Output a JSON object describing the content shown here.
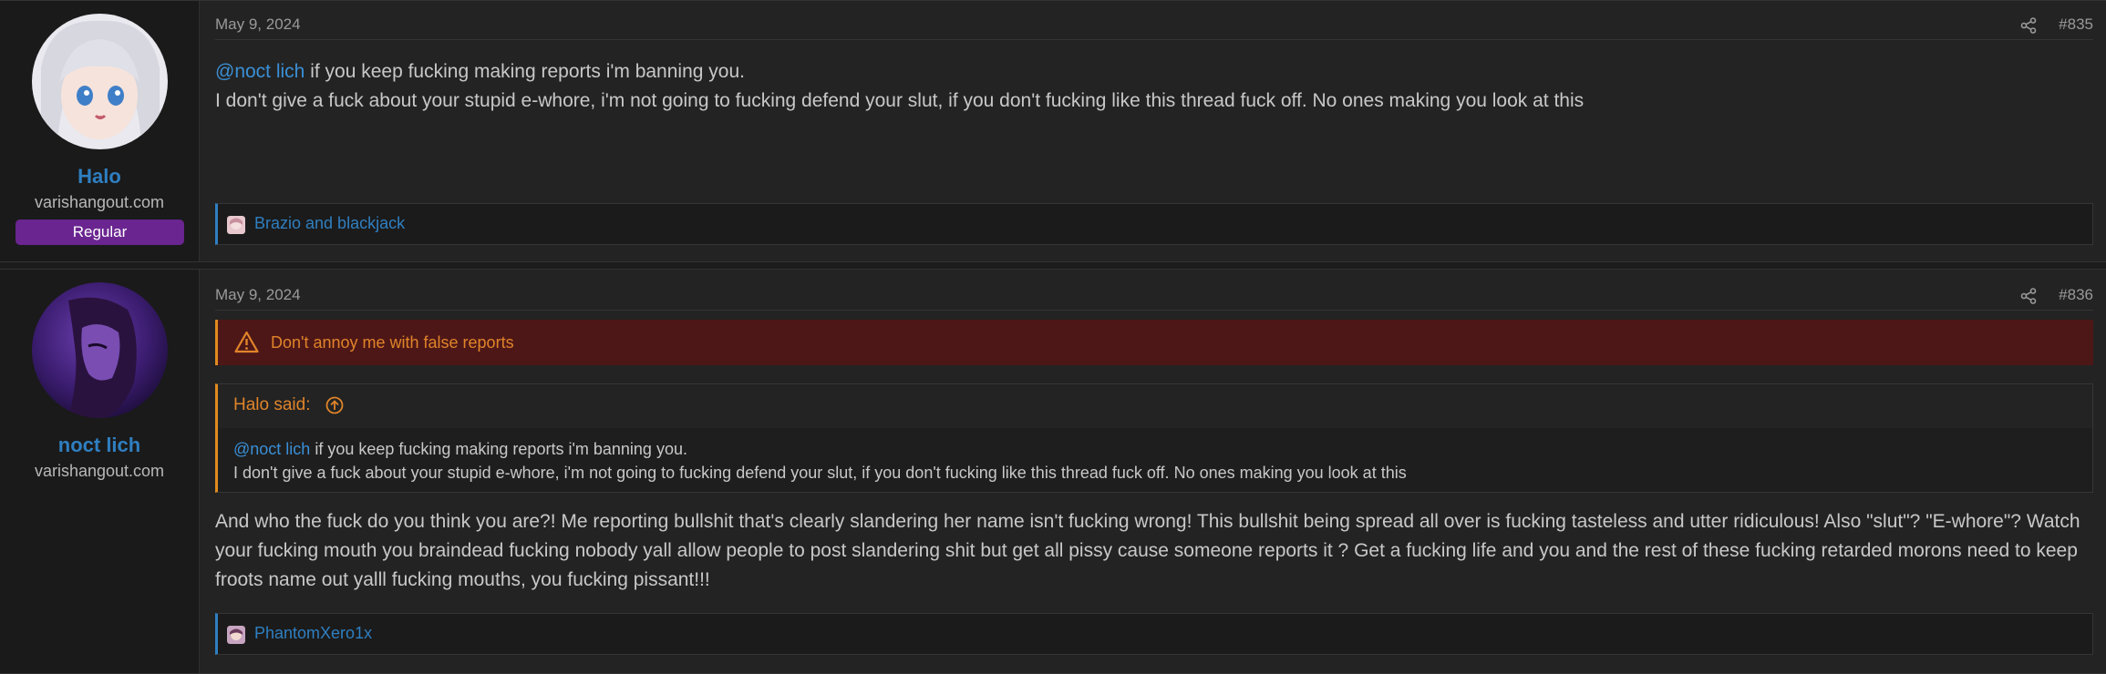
{
  "posts": [
    {
      "username": "Halo",
      "site": "varishangout.com",
      "banner": "Regular",
      "date": "May 9, 2024",
      "number": "#835",
      "mention": "@noct lich",
      "line1_rest": " if you keep fucking making reports i'm banning you.",
      "line2": "I don't give a fuck about your stupid e-whore, i'm not going to fucking defend your slut, if you don't fucking like this thread fuck off. No ones making you look at this",
      "reactions": "Brazio and blackjack"
    },
    {
      "username": "noct lich",
      "site": "varishangout.com",
      "date": "May 9, 2024",
      "number": "#836",
      "notice": "Don't annoy me with false reports",
      "quote": {
        "author": "Halo said:",
        "mention": "@noct lich",
        "line1_rest": " if you keep fucking making reports i'm banning you.",
        "line2": "I don't give a fuck about your stupid e-whore, i'm not going to fucking defend your slut, if you don't fucking like this thread fuck off. No ones making you look at this"
      },
      "body": "And who the fuck do you think you are?! Me reporting bullshit that's clearly slandering her name isn't fucking wrong! This bullshit being spread all over is fucking tasteless and utter ridiculous! Also \"slut\"? \"E-whore\"? Watch your fucking mouth you braindead fucking nobody yall allow people to post slandering shit but get all pissy cause someone reports it ? Get a fucking life and you and the rest of these fucking retarded morons need to keep froots name out yalll fucking mouths, you fucking pissant!!!",
      "reactions": "PhantomXero1x"
    }
  ],
  "icons": {
    "share": "share-icon",
    "warning": "warning-icon",
    "quote_jump": "arrow-up-circle-icon"
  },
  "colors": {
    "link": "#2f7fc1",
    "banner_regular": "#6a2590",
    "notice_bg": "#4e1717",
    "notice_text": "#e0842a"
  }
}
